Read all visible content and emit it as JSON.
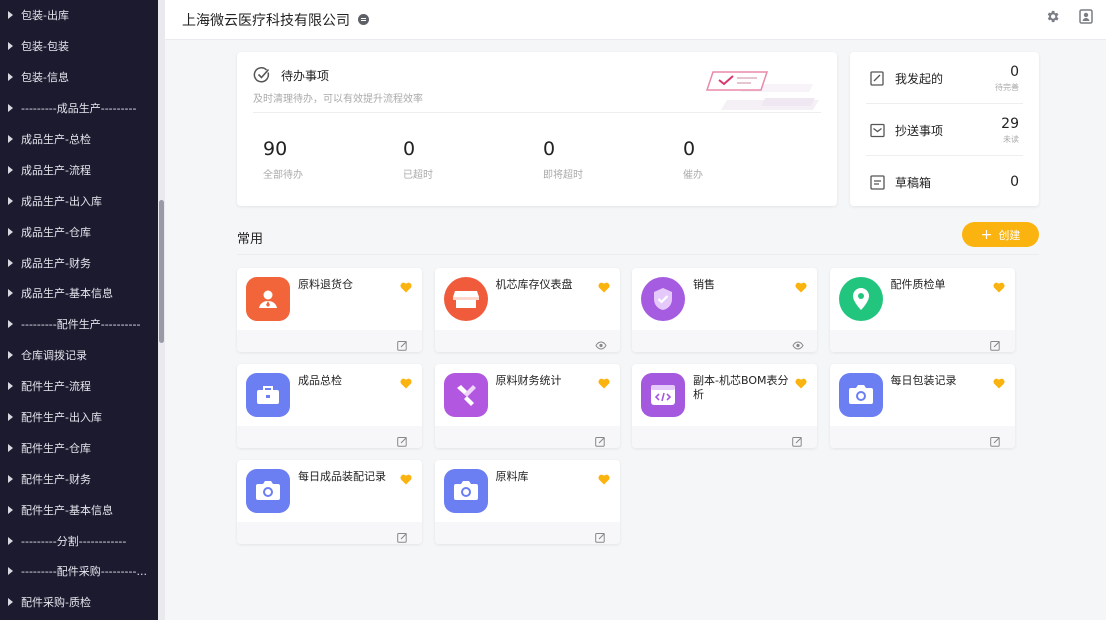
{
  "sidebar": {
    "items": [
      {
        "label": "包装-出库"
      },
      {
        "label": "包装-包装"
      },
      {
        "label": "包装-信息"
      },
      {
        "label": "---------成品生产---------"
      },
      {
        "label": "成品生产-总检"
      },
      {
        "label": "成品生产-流程"
      },
      {
        "label": "成品生产-出入库"
      },
      {
        "label": "成品生产-仓库"
      },
      {
        "label": "成品生产-财务"
      },
      {
        "label": "成品生产-基本信息"
      },
      {
        "label": "---------配件生产----------"
      },
      {
        "label": "仓库调拨记录"
      },
      {
        "label": "配件生产-流程"
      },
      {
        "label": "配件生产-出入库"
      },
      {
        "label": "配件生产-仓库"
      },
      {
        "label": "配件生产-财务"
      },
      {
        "label": "配件生产-基本信息"
      },
      {
        "label": "---------分割------------"
      },
      {
        "label": "---------配件采购---------..."
      },
      {
        "label": "配件采购-质检"
      }
    ]
  },
  "header": {
    "company": "上海微云医疗科技有限公司"
  },
  "todo": {
    "title": "待办事项",
    "subtitle": "及时清理待办，可以有效提升流程效率",
    "stats": [
      {
        "value": "90",
        "label": "全部待办"
      },
      {
        "value": "0",
        "label": "已超时"
      },
      {
        "value": "0",
        "label": "即将超时"
      },
      {
        "value": "0",
        "label": "催办"
      }
    ]
  },
  "mine": {
    "rows": [
      {
        "label": "我发起的",
        "value": "0",
        "sub": "待完善"
      },
      {
        "label": "抄送事项",
        "value": "29",
        "sub": "未读"
      },
      {
        "label": "草稿箱",
        "value": "0",
        "sub": ""
      }
    ]
  },
  "common": {
    "title": "常用",
    "create_label": "创建"
  },
  "apps": [
    {
      "name": "原料退货仓",
      "icon": "user-group-icon",
      "color": "#f2653a",
      "foot": "edit"
    },
    {
      "name": "机芯库存仪表盘",
      "icon": "store-icon",
      "color": "#f05b3c",
      "foot": "view"
    },
    {
      "name": "销售",
      "icon": "shield-icon",
      "color": "#a55ce0",
      "foot": "view"
    },
    {
      "name": "配件质检单",
      "icon": "location-icon",
      "color": "#22c57d",
      "foot": "edit"
    },
    {
      "name": "成品总检",
      "icon": "toolbox-icon",
      "color": "#6b7ef2",
      "foot": "edit"
    },
    {
      "name": "原料财务统计",
      "icon": "tools-icon",
      "color": "#b157e0",
      "foot": "edit"
    },
    {
      "name": "副本-机芯BOM表分析",
      "icon": "code-window-icon",
      "color": "#a559df",
      "foot": "edit"
    },
    {
      "name": "每日包装记录",
      "icon": "camera-icon",
      "color": "#6b7ef2",
      "foot": "edit"
    },
    {
      "name": "每日成品装配记录",
      "icon": "camera-icon",
      "color": "#6b7ef2",
      "foot": "edit"
    },
    {
      "name": "原料库",
      "icon": "camera-icon",
      "color": "#6b7ef2",
      "foot": "edit"
    }
  ],
  "colors": {
    "sidebar_bg": "#1b1a2f",
    "accent": "#fbb40f",
    "favorite": "#fbb40f"
  }
}
